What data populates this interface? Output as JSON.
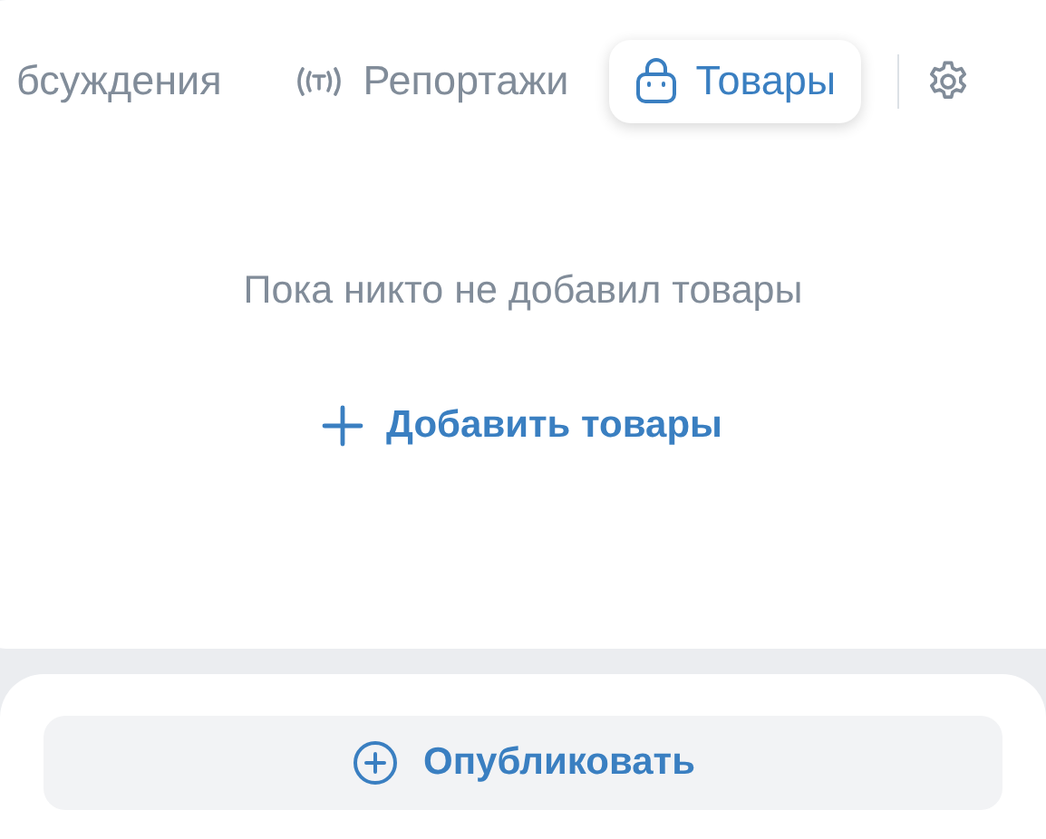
{
  "tabs": [
    {
      "label": "бсуждения",
      "selected": false,
      "kind": "plain"
    },
    {
      "label": "Репортажи",
      "selected": false,
      "kind": "broadcast"
    },
    {
      "label": "Товары",
      "selected": true,
      "kind": "shop"
    }
  ],
  "empty_message": "Пока никто не добавил товары",
  "add_button": {
    "label": "Добавить товары"
  },
  "publish_button": {
    "label": "Опубликовать"
  }
}
